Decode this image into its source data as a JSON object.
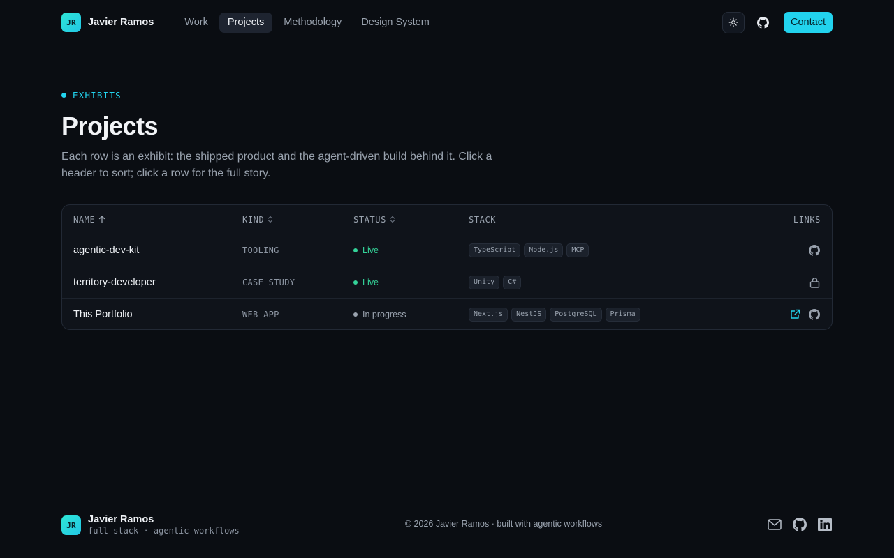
{
  "header": {
    "logo_initials": "JR",
    "brand_name": "Javier Ramos",
    "nav": [
      {
        "label": "Work",
        "active": false
      },
      {
        "label": "Projects",
        "active": true
      },
      {
        "label": "Methodology",
        "active": false
      },
      {
        "label": "Design System",
        "active": false
      }
    ],
    "theme_icon": "sun-icon",
    "github_icon": "github-icon",
    "contact_label": "Contact"
  },
  "main": {
    "eyebrow": "EXHIBITS",
    "title": "Projects",
    "subtitle": "Each row is an exhibit: the shipped product and the agent-driven build behind it. Click a header to sort; click a row for the full story."
  },
  "table": {
    "columns": {
      "name": "NAME",
      "kind": "KIND",
      "status": "STATUS",
      "stack": "STACK",
      "links": "LINKS"
    },
    "sort": {
      "column": "name",
      "direction": "ascending"
    },
    "rows": [
      {
        "name": "agentic-dev-kit",
        "kind": "TOOLING",
        "status": "Live",
        "status_color": "#34d399",
        "stack": [
          "TypeScript",
          "Node.js",
          "MCP"
        ],
        "links": [
          "github-icon"
        ]
      },
      {
        "name": "territory-developer",
        "kind": "CASE_STUDY",
        "status": "Live",
        "status_color": "#34d399",
        "stack": [
          "Unity",
          "C#"
        ],
        "links": [
          "lock-icon"
        ]
      },
      {
        "name": "This Portfolio",
        "kind": "WEB_APP",
        "status": "In progress",
        "status_color": "#9aa3af",
        "stack": [
          "Next.js",
          "NestJS",
          "PostgreSQL",
          "Prisma"
        ],
        "links": [
          "external-link-icon",
          "github-icon"
        ]
      }
    ]
  },
  "footer": {
    "logo_initials": "JR",
    "name": "Javier Ramos",
    "tagline": "full-stack · agentic workflows",
    "copyright": "© 2026 Javier Ramos · built with agentic workflows",
    "socials": [
      "mail-icon",
      "github-icon",
      "linkedin-icon"
    ]
  },
  "colors": {
    "accent": "#22d3ee",
    "background": "#0a0d12",
    "live": "#34d399"
  }
}
